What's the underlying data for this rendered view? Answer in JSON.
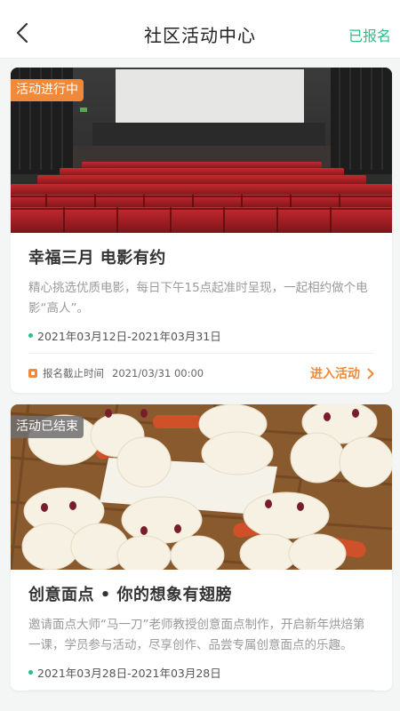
{
  "header": {
    "title": "社区活动中心",
    "registered_label": "已报名"
  },
  "colors": {
    "accent_green": "#2bbf87",
    "accent_orange": "#f08a3a",
    "ended_badge": "#8a8a8a"
  },
  "activities": [
    {
      "status": "活动进行中",
      "title": "幸福三月 电影有约",
      "description": "精心挑选优质电影，每日下午15点起准时呈现，一起相约做个电影“高人”。",
      "date_range": "2021年03月12日-2021年03月31日",
      "deadline_label": "报名截止时间",
      "deadline_value": "2021/03/31 00:00",
      "action_label": "进入活动"
    },
    {
      "status": "活动已结束",
      "title": "创意面点 • 你的想象有翅膀",
      "description": "邀请面点大师“马一刀”老师教授创意面点制作，开启新年烘焙第一课，学员参与活动，尽享创作、品尝专属创意面点的乐趣。",
      "date_range": "2021年03月28日-2021年03月28日"
    }
  ]
}
